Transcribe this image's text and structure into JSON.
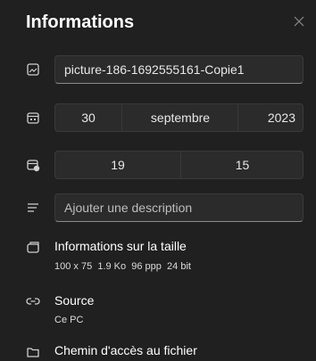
{
  "panel": {
    "title": "Informations",
    "close_icon": "close-icon"
  },
  "filename": {
    "icon": "image-icon",
    "value": "picture-186-1692555161-Copie1"
  },
  "date": {
    "icon": "calendar-icon",
    "day": "30",
    "month": "septembre",
    "year": "2023"
  },
  "time": {
    "icon": "clock-calendar-icon",
    "hour": "19",
    "minute": "15"
  },
  "description": {
    "icon": "text-lines-icon",
    "placeholder": "Ajouter une description"
  },
  "size_info": {
    "icon": "image-size-icon",
    "title": "Informations sur la taille",
    "dimensions": "100 x 75",
    "filesize": "1.9 Ko",
    "dpi": "96 ppp",
    "bitdepth": "24 bit"
  },
  "source": {
    "icon": "link-icon",
    "title": "Source",
    "value": "Ce PC"
  },
  "path": {
    "icon": "folder-icon",
    "title": "Chemin d'accès au fichier"
  }
}
